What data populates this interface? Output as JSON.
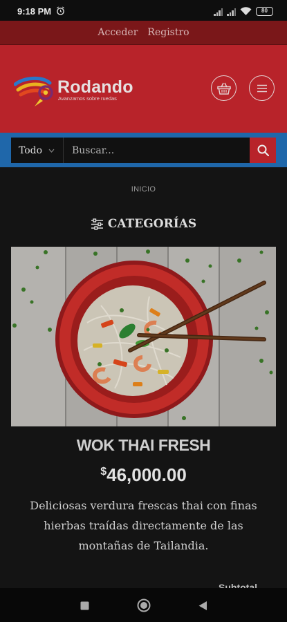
{
  "status_bar": {
    "time": "9:18 PM",
    "battery": "80"
  },
  "top_links": {
    "login": "Acceder",
    "register": "Registro"
  },
  "brand": {
    "name": "Rodando",
    "tagline": "Avanzamos sobre ruedas"
  },
  "search": {
    "category": "Todo",
    "placeholder": "Buscar..."
  },
  "breadcrumb": "INICIO",
  "section_title": "CATEGORÍAS",
  "product": {
    "title": "WOK THAI FRESH",
    "currency": "$",
    "price": "46,000.00",
    "description": "Deliciosas verdura frescas thai con finas hierbas traídas directamente de las montañas de Tailandia."
  },
  "peek_text": "Subtotal",
  "colors": {
    "header_red": "#b8232a",
    "topbar_red": "#7a1719",
    "search_blue": "#1f67aa",
    "background": "#141414"
  }
}
